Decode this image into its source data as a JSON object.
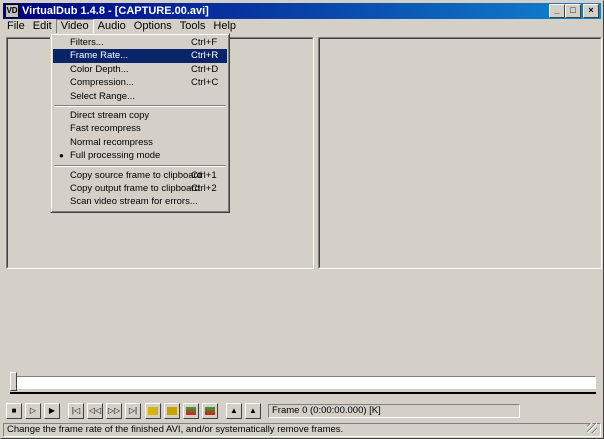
{
  "window": {
    "app_icon_text": "VD",
    "title": "VirtualDub 1.4.8 - [CAPTURE.00.avi]",
    "minimize": "_",
    "maximize": "□",
    "close": "×"
  },
  "menubar": {
    "items": [
      {
        "label": "File"
      },
      {
        "label": "Edit"
      },
      {
        "label": "Video"
      },
      {
        "label": "Audio"
      },
      {
        "label": "Options"
      },
      {
        "label": "Tools"
      },
      {
        "label": "Help"
      }
    ]
  },
  "video_menu": {
    "items": [
      {
        "label": "Filters...",
        "shortcut": "Ctrl+F"
      },
      {
        "label": "Frame Rate...",
        "shortcut": "Ctrl+R",
        "highlighted": true
      },
      {
        "label": "Color Depth...",
        "shortcut": "Ctrl+D"
      },
      {
        "label": "Compression...",
        "shortcut": "Ctrl+C"
      },
      {
        "label": "Select Range..."
      },
      {
        "label": "Direct stream copy"
      },
      {
        "label": "Fast recompress"
      },
      {
        "label": "Normal recompress"
      },
      {
        "label": "Full processing mode",
        "checked": true
      },
      {
        "label": "Copy source frame to clipboard",
        "shortcut": "Ctrl+1"
      },
      {
        "label": "Copy output frame to clipboard",
        "shortcut": "Ctrl+2"
      },
      {
        "label": "Scan video stream for errors..."
      }
    ],
    "check_mark": "●"
  },
  "toolbar": {
    "frame_readout": "Frame 0 (0:00:00.000) [K]",
    "glyphs": {
      "stop": "■",
      "play_input": "▷",
      "play_output": "▶",
      "start": "|◁",
      "prev": "◁◁",
      "next": "▷▷",
      "end": "▷|",
      "mark_in": "▲",
      "mark_out": "▲"
    }
  },
  "statusbar": {
    "text": "Change the frame rate of the finished AVI, and/or systematically remove frames."
  }
}
